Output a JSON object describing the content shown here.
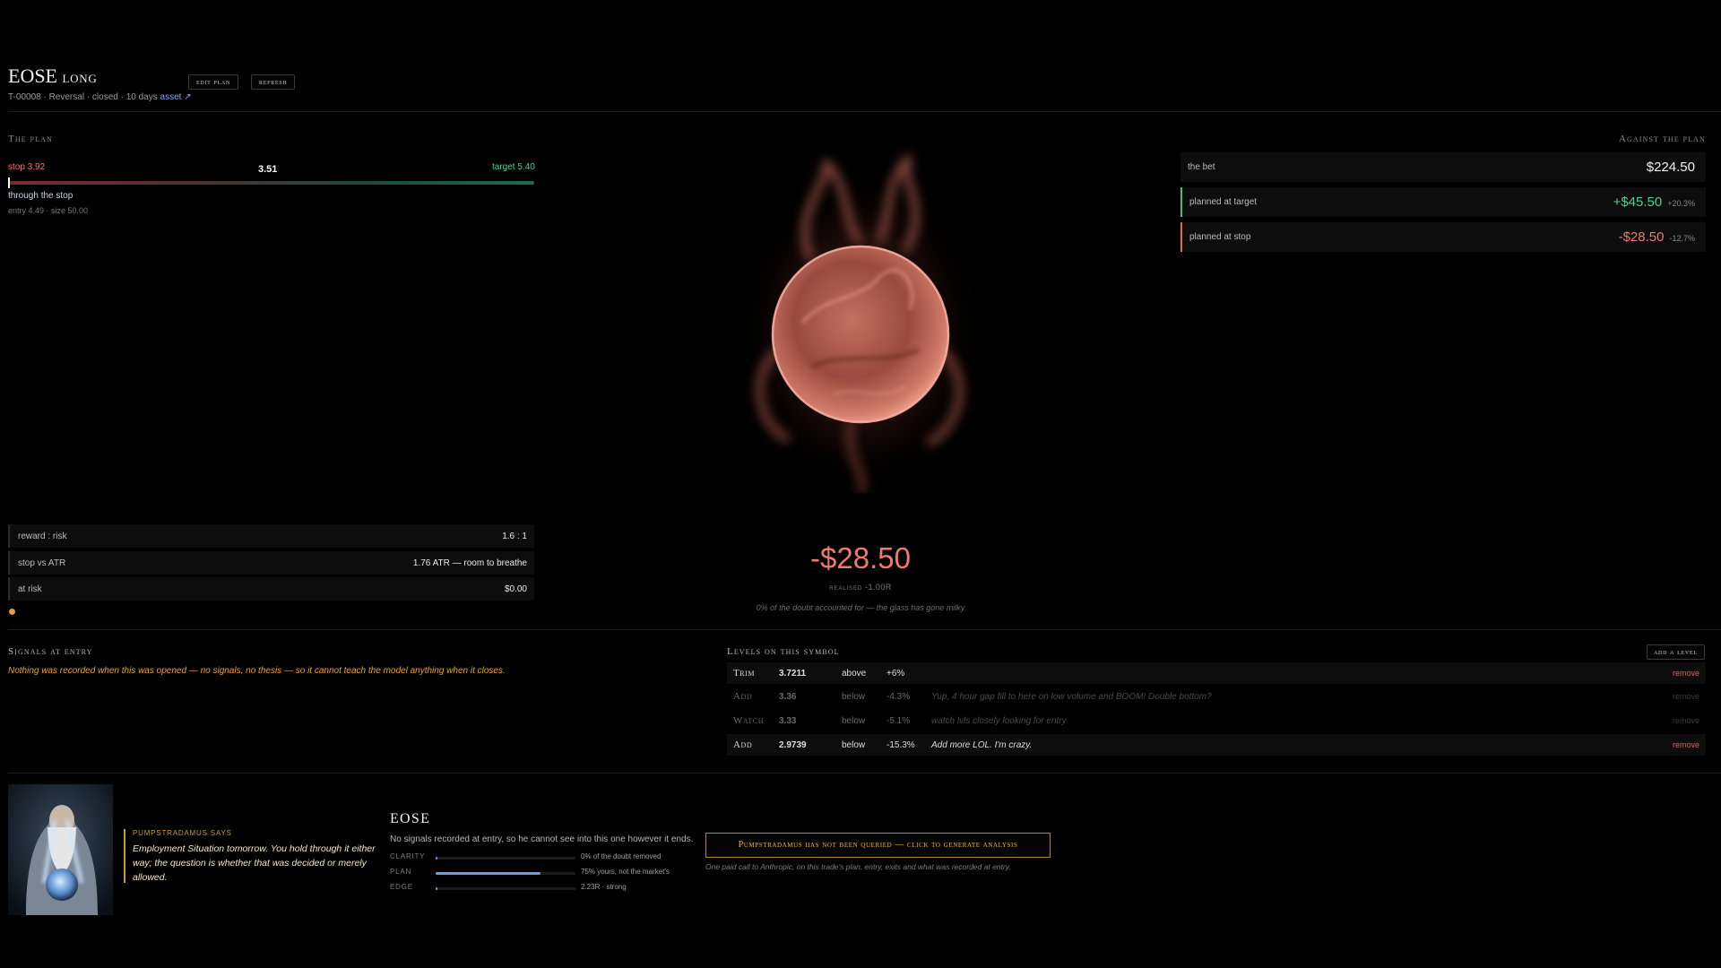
{
  "header": {
    "symbol": "EOSE",
    "direction": "long",
    "subtitle": "T-00008 · Reversal · closed · 10 days",
    "asset_link": "asset ↗",
    "edit_label": "edit plan",
    "refresh_label": "refresh"
  },
  "plan": {
    "label": "The plan",
    "stop_label": "stop 3.92",
    "current_label": "3.51",
    "target_label": "target 5.40",
    "status": "through the stop",
    "entry_info": "entry 4.49 · size 50.00",
    "metrics": [
      {
        "key": "reward : risk",
        "value": "1.6 : 1"
      },
      {
        "key": "stop vs ATR",
        "value": "1.76 ATR — room to breathe"
      },
      {
        "key": "at risk",
        "value": "$0.00"
      }
    ]
  },
  "orb": {
    "pnl": "-$28.50",
    "realised_label": "realised",
    "realised_r": "-1.00R",
    "doubt_text": "0% of the doubt accounted for — the glass has gone milky",
    "color": "#e8806e"
  },
  "against": {
    "label": "Against the plan",
    "rows": [
      {
        "key": "the bet",
        "value": "$224.50",
        "pct": ""
      },
      {
        "key": "planned at target",
        "value": "+$45.50",
        "pct": "+20.3%"
      },
      {
        "key": "planned at stop",
        "value": "-$28.50",
        "pct": "-12.7%"
      }
    ]
  },
  "signals": {
    "label": "Signals at entry",
    "message": "Nothing was recorded when this was opened — no signals, no thesis — so it cannot teach the model anything when it closes."
  },
  "levels": {
    "label": "Levels on this symbol",
    "add_label": "add a level",
    "rows": [
      {
        "type": "Trim",
        "price": "3.7211",
        "rel": "above",
        "pct": "+6%",
        "note": "",
        "remove": "remove"
      },
      {
        "type": "Add",
        "price": "3.36",
        "rel": "below",
        "pct": "-4.3%",
        "note": "Yup, 4 hour gap fill to here on low volume and BOOM! Double bottom?",
        "remove": "remove"
      },
      {
        "type": "Watch",
        "price": "3.33",
        "rel": "below",
        "pct": "-5.1%",
        "note": "watch lvls closely looking for entry",
        "remove": "remove"
      },
      {
        "type": "Add",
        "price": "2.9739",
        "rel": "below",
        "pct": "-15.3%",
        "note": "Add more LOL. I'm crazy.",
        "remove": "remove"
      }
    ]
  },
  "oracle": {
    "says_label": "PUMPSTRADAMUS SAYS",
    "says_text": "Employment Situation tomorrow. You hold through it either way; the question is whether that was decided or merely allowed.",
    "symbol": "EOSE",
    "sub": "No signals recorded at entry, so he cannot see into this one however it ends.",
    "meters": [
      {
        "label": "CLARITY",
        "fill": 0.01,
        "value": "0% of the doubt removed"
      },
      {
        "label": "PLAN",
        "fill": 0.75,
        "value": "75% yours, not the market's"
      },
      {
        "label": "EDGE",
        "fill": 0.01,
        "value": "2.23R · strong"
      }
    ],
    "query_label": "Pumpstradamus has not been queried — click to generate analysis",
    "query_sub": "One paid call to Anthropic, on this trade's plan, entry, exits and what was recorded at entry."
  }
}
